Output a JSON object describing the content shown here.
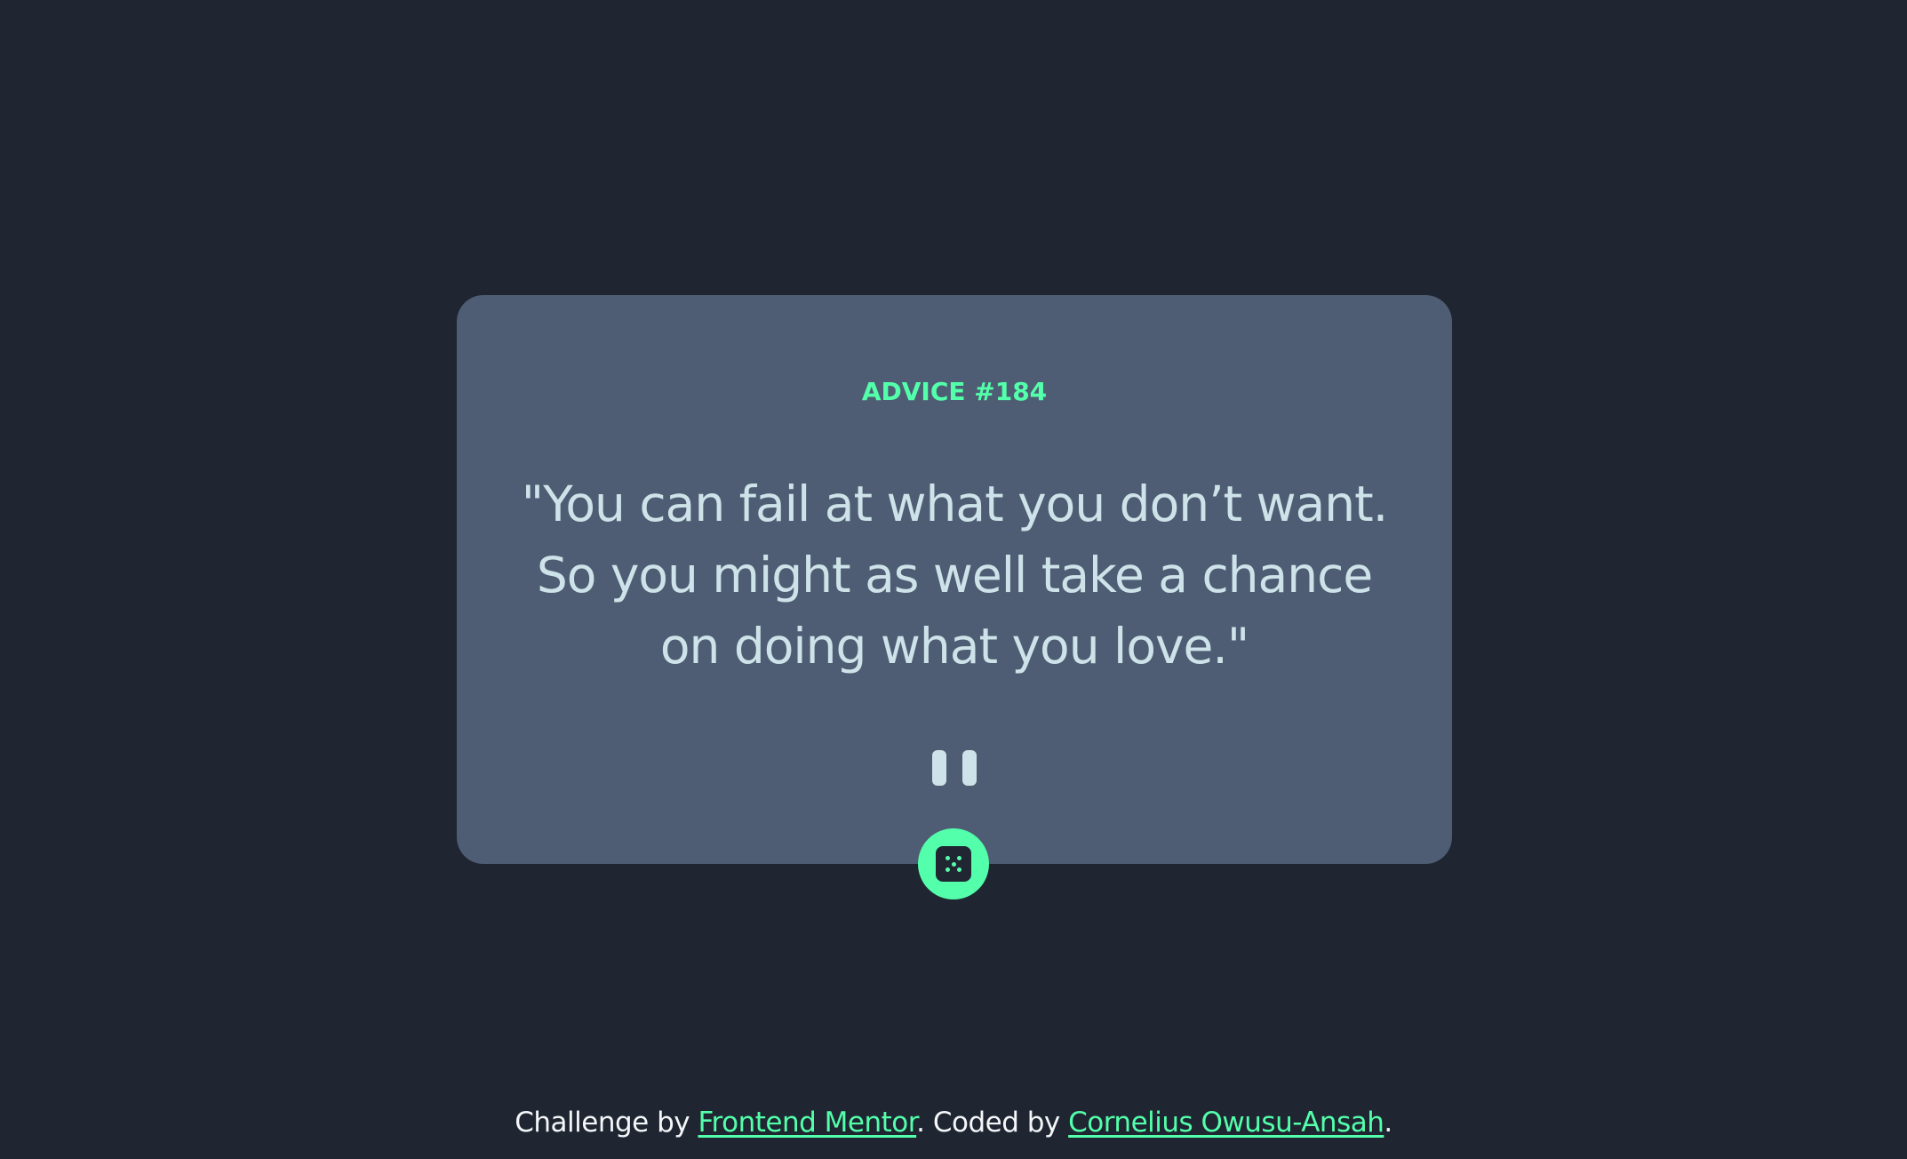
{
  "card": {
    "advice_label": "ADVICE #184",
    "quote": "\"You can fail at what you don’t want. So you might as well take a chance on doing what you love.\""
  },
  "dice_button": {
    "icon": "dice-icon"
  },
  "footer": {
    "prefix": "Challenge by ",
    "link1": "Frontend Mentor",
    "middle": ". Coded by ",
    "link2": "Cornelius Owusu-Ansah",
    "suffix": "."
  },
  "colors": {
    "background": "#1f2632",
    "card": "#4e5d73",
    "accent": "#53ffaa",
    "text": "#cee3e9"
  }
}
